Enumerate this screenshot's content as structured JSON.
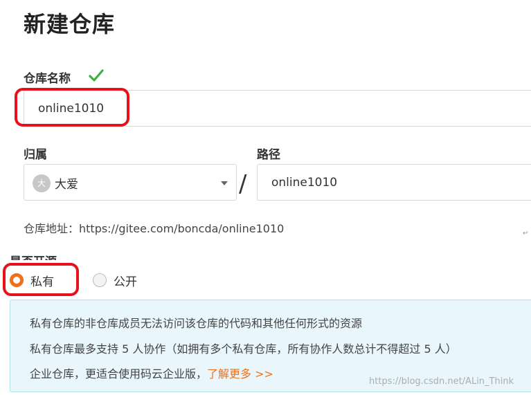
{
  "page": {
    "title": "新建仓库"
  },
  "repo_name": {
    "label": "仓库名称",
    "value": "online1010",
    "status_icon": "check-icon"
  },
  "owner": {
    "label": "归属",
    "avatar_text": "大",
    "name": "大爱"
  },
  "separator": "/",
  "path": {
    "label": "路径",
    "value": "online1010"
  },
  "repo_address": "仓库地址：https://gitee.com/boncda/online1010",
  "open_source": {
    "label": "是否开源",
    "options": [
      {
        "label": "私有",
        "checked": true
      },
      {
        "label": "公开",
        "checked": false
      }
    ]
  },
  "info": {
    "line1": "私有仓库的非仓库成员无法访问该仓库的代码和其他任何形式的资源",
    "line2": "私有仓库最多支持 5 人协作（如拥有多个私有仓库，所有协作人数总计不得超过 5 人）",
    "line3": "企业仓库，更适合使用码云企业版，",
    "link": "了解更多 >>"
  },
  "watermark": "https://blog.csdn.net/ALin_Think",
  "colors": {
    "accent_orange": "#f0701a",
    "check_green": "#3cb043",
    "annotation_red": "#e8111b",
    "info_bg": "#e9f6fb"
  }
}
